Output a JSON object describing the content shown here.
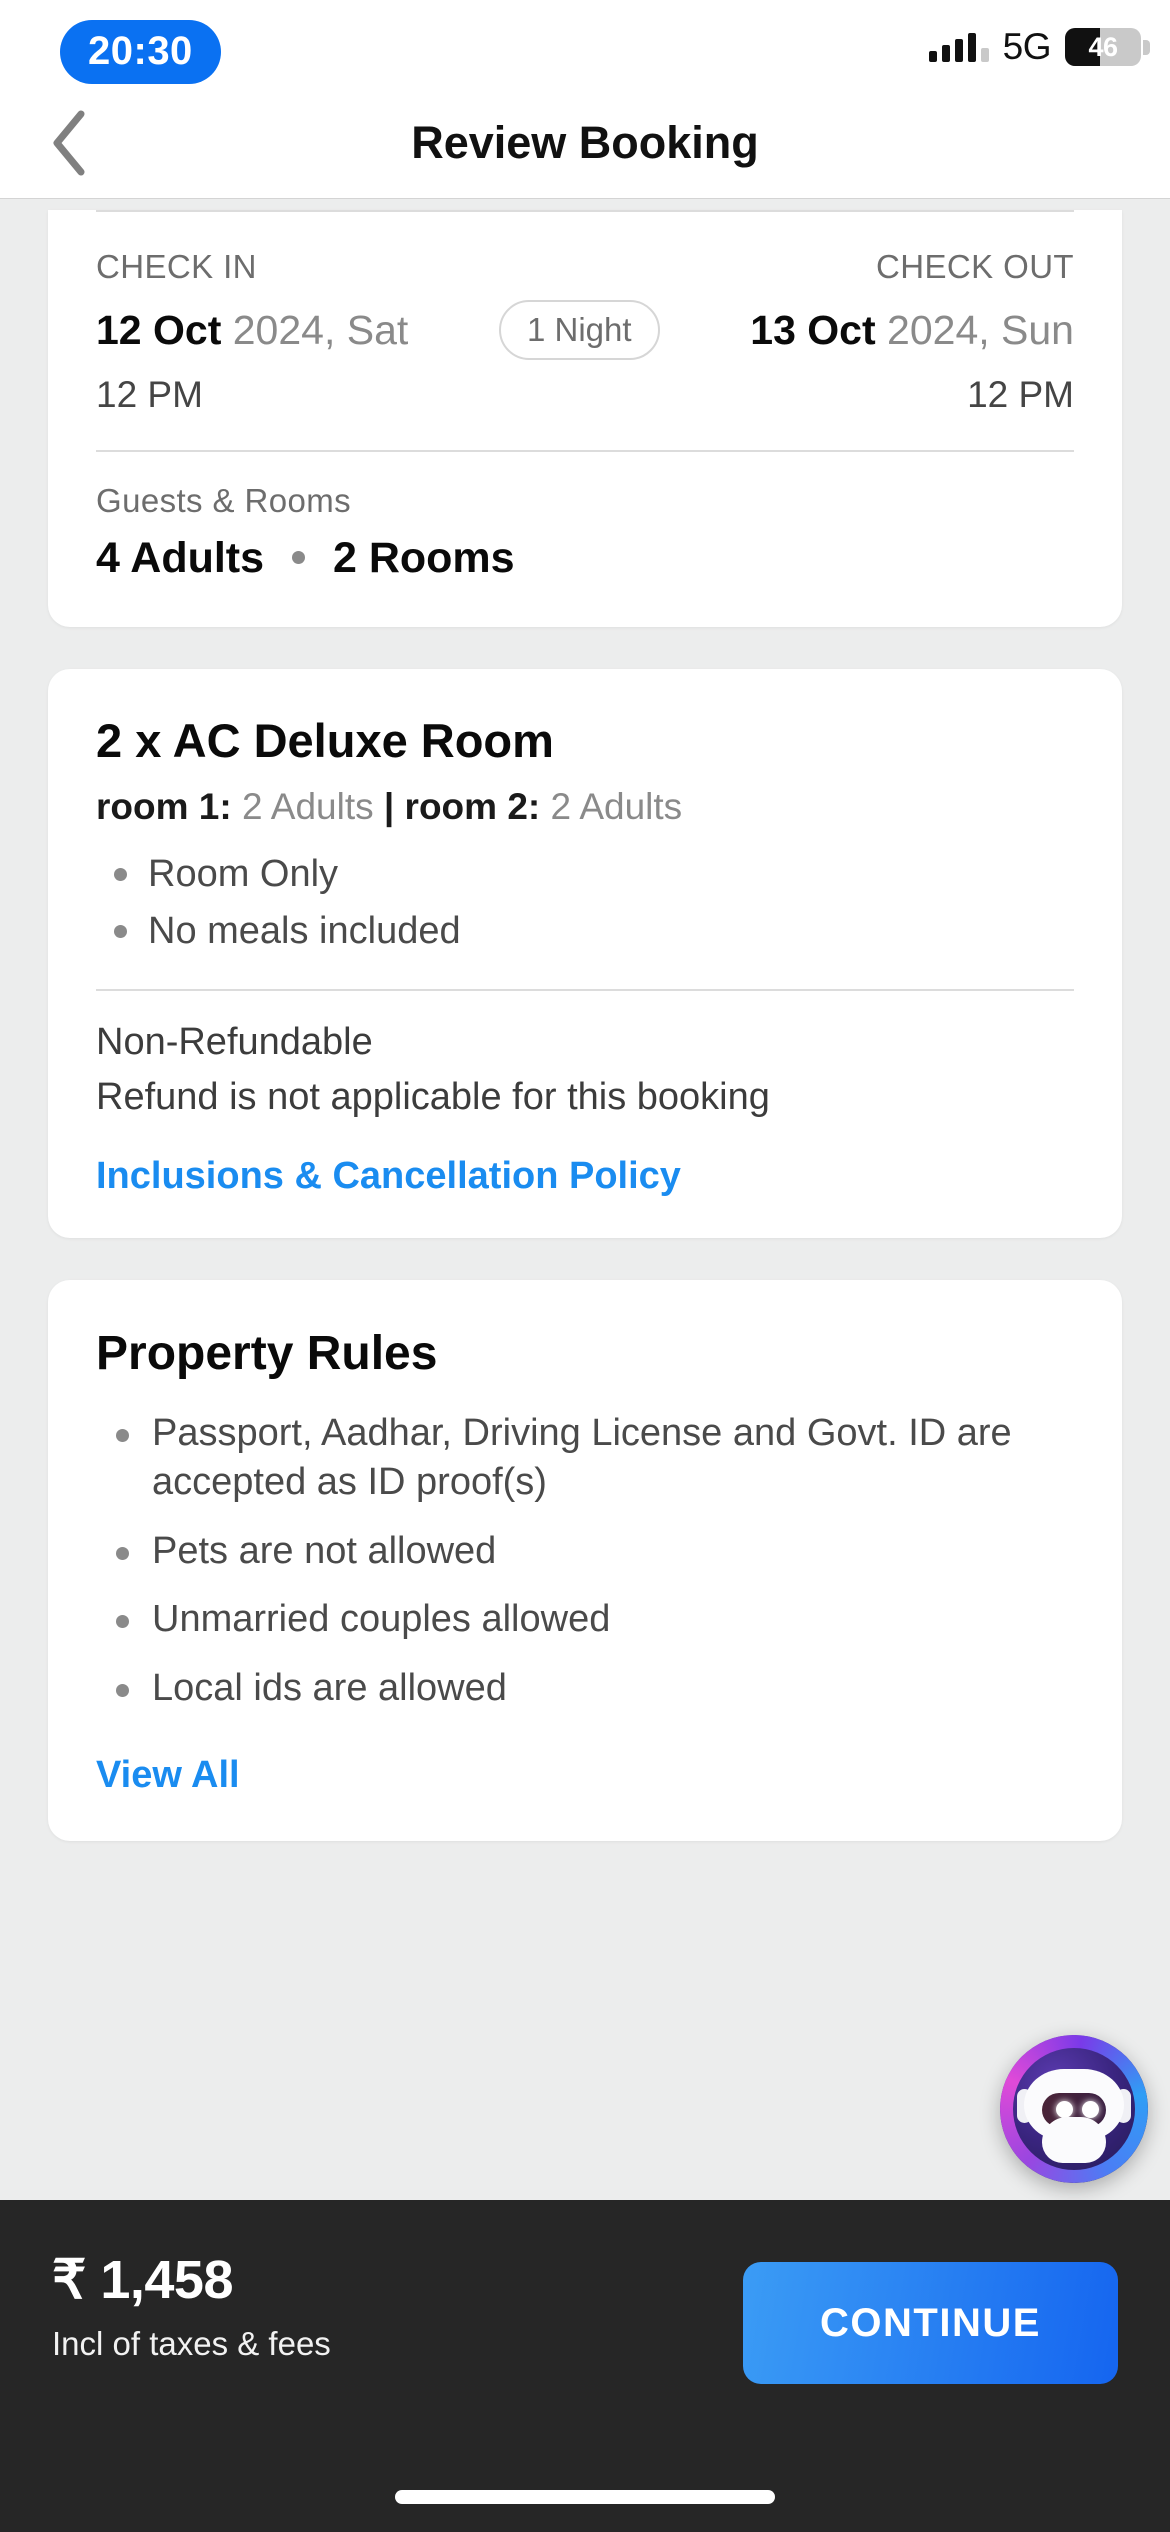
{
  "status_bar": {
    "time": "20:30",
    "network": "5G",
    "battery_level": "46",
    "battery_percent": 46,
    "signal_icon": "signal-bars-icon",
    "battery_icon": "battery-icon"
  },
  "nav": {
    "back_icon": "chevron-left-icon",
    "title": "Review Booking"
  },
  "stay_card": {
    "check_in_label": "CHECK IN",
    "check_out_label": "CHECK OUT",
    "check_in_date_bold": "12 Oct",
    "check_in_date_rest": "2024, Sat",
    "check_out_date_bold": "13 Oct",
    "check_out_date_rest": "2024, Sun",
    "nights_badge": "1 Night",
    "check_in_time": "12 PM",
    "check_out_time": "12 PM",
    "guests_rooms_label": "Guests & Rooms",
    "adults": "4 Adults",
    "rooms": "2 Rooms"
  },
  "room_card": {
    "title": "2 x AC Deluxe Room",
    "occupancy_room1_label": "room 1:",
    "occupancy_room1_value": " 2 Adults ",
    "occupancy_separator": "| ",
    "occupancy_room2_label": "room 2:",
    "occupancy_room2_value": " 2 Adults",
    "inclusions": [
      "Room Only",
      "No meals included"
    ],
    "refund_title": "Non-Refundable",
    "refund_subtitle": "Refund is not applicable for this booking",
    "policy_link": "Inclusions & Cancellation Policy"
  },
  "rules_card": {
    "title": "Property Rules",
    "rules": [
      "Passport, Aadhar, Driving License and Govt. ID are accepted as ID proof(s)",
      "Pets are not allowed",
      "Unmarried couples allowed",
      "Local ids are allowed"
    ],
    "view_all_link": "View All"
  },
  "chatbot": {
    "icon": "chatbot-robot-icon"
  },
  "bottom_bar": {
    "price": "₹ 1,458",
    "price_subtitle": "Incl of taxes & fees",
    "continue_label": "CONTINUE"
  },
  "colors": {
    "accent_blue": "#1a8cf0",
    "primary_blue": "#1565f0",
    "bottom_bar_bg": "#262626",
    "page_bg": "#eceded"
  }
}
